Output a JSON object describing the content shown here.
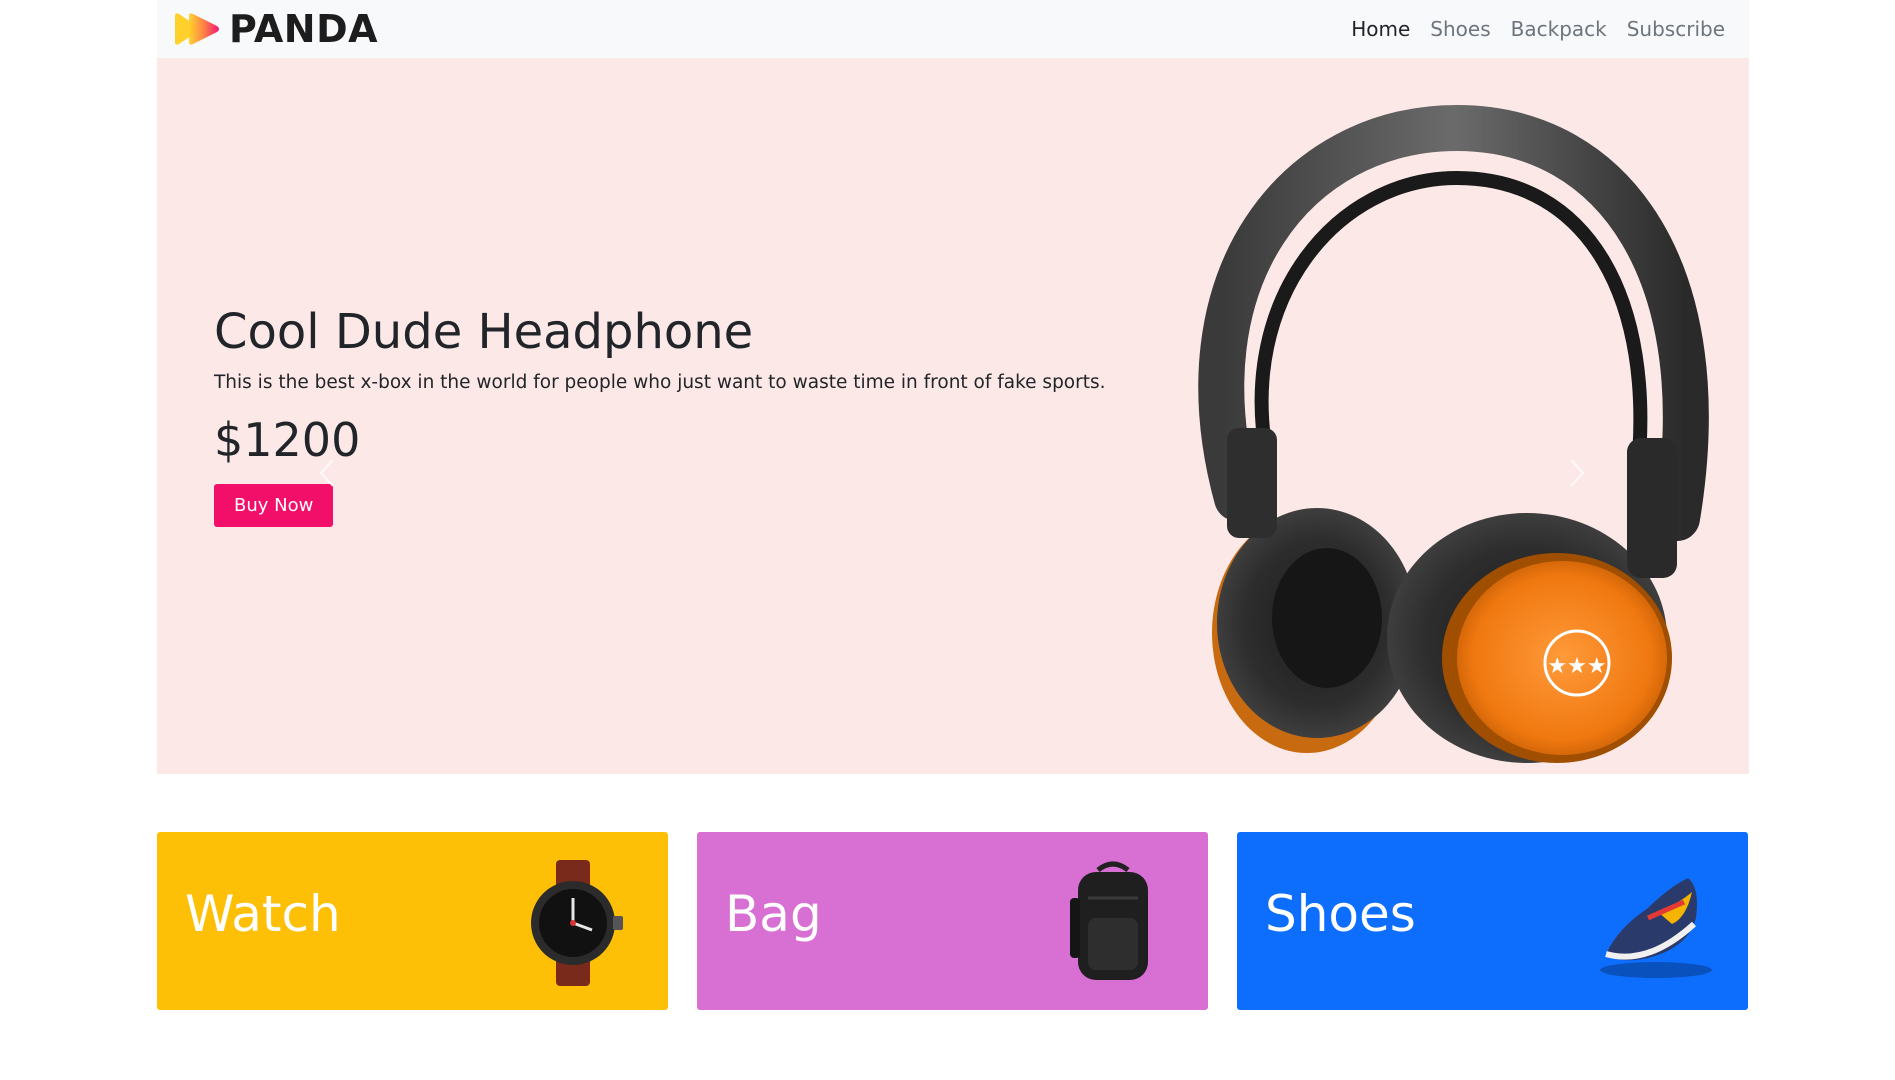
{
  "brand": {
    "name": "PANDA",
    "logo_colors": [
      "#ffd12a",
      "#ff7a3b",
      "#f20f6a"
    ]
  },
  "nav": {
    "items": [
      {
        "label": "Home",
        "active": true
      },
      {
        "label": "Shoes",
        "active": false
      },
      {
        "label": "Backpack",
        "active": false
      },
      {
        "label": "Subscribe",
        "active": false
      }
    ]
  },
  "hero": {
    "title": "Cool Dude Headphone",
    "description": "This is the best x-box in the world for people who just want to waste time in front of fake sports.",
    "price": "$1200",
    "cta_label": "Buy Now",
    "background": "#fbe8e7",
    "cta_color": "#f20f6a",
    "image_icon": "headphones-icon"
  },
  "categories": [
    {
      "label": "Watch",
      "color": "#fdc007",
      "icon": "watch-icon"
    },
    {
      "label": "Bag",
      "color": "#d86fd3",
      "icon": "backpack-icon"
    },
    {
      "label": "Shoes",
      "color": "#0d6efd",
      "icon": "sneaker-icon"
    }
  ]
}
